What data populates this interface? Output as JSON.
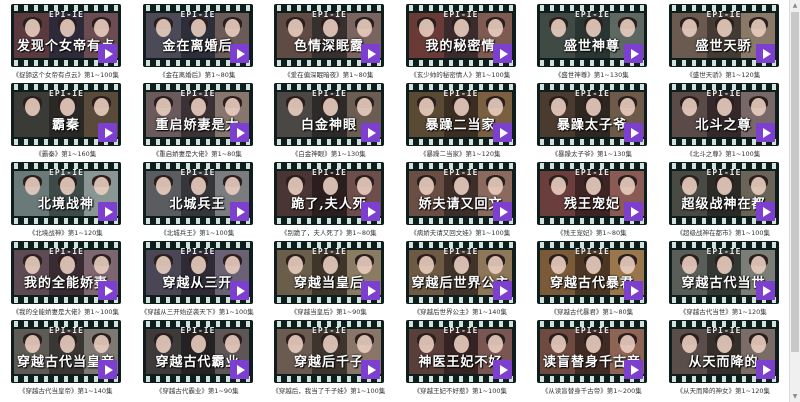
{
  "app": {
    "logo_text": "EPI-IE"
  },
  "videos": [
    {
      "caption": "发现个女帝有点",
      "label": "《捉舔这个女帝有点云》第1~100集",
      "c1": "#5b3a3f",
      "c2": "#2e2a3a",
      "c3": "#6b4c52"
    },
    {
      "caption": "金在离婚后",
      "label": "《金在离婚后》第1~80集",
      "c1": "#4b4a56",
      "c2": "#2c2f3a",
      "c3": "#6a5a58"
    },
    {
      "caption": "色情深眠露",
      "label": "《爱在偏深眠暗夜》第1~80集",
      "c1": "#5f4a44",
      "c2": "#37302f",
      "c3": "#7a6460"
    },
    {
      "caption": "我的秘密情",
      "label": "《玄少帅的秘密情人》第1~100集",
      "c1": "#6a3b36",
      "c2": "#3b2b2d",
      "c3": "#7e5a50"
    },
    {
      "caption": "盛世神尊",
      "label": "《盛世神尊》第1~130集",
      "c1": "#3f4a45",
      "c2": "#2a3532",
      "c3": "#5d6863"
    },
    {
      "caption": "盛世天骄",
      "label": "《盛世天骄》第1~120集",
      "c1": "#6a5a50",
      "c2": "#433a34",
      "c3": "#8a7868"
    },
    {
      "caption": "霸秦",
      "label": "《霸秦》第1~160集",
      "c1": "#3a3a36",
      "c2": "#2a2824",
      "c3": "#5a4a3a"
    },
    {
      "caption": "重启娇妻是太",
      "label": "《重启娇妻是大佬》第1~80集",
      "c1": "#6a5a5c",
      "c2": "#3a3234",
      "c3": "#86766e"
    },
    {
      "caption": "白金神眼",
      "label": "《白金神眼》第1~130集",
      "c1": "#4a4744",
      "c2": "#2c2b2a",
      "c3": "#6b5d52"
    },
    {
      "caption": "暴躁二当家",
      "label": "《暴躁二当家》第1~120集",
      "c1": "#5a4a34",
      "c2": "#3a2e22",
      "c3": "#7a6040"
    },
    {
      "caption": "暴躁太子爷",
      "label": "《暴躁太子爷》第1~130集",
      "c1": "#4a3a30",
      "c2": "#2e2620",
      "c3": "#6e5a48"
    },
    {
      "caption": "北斗之尊",
      "label": "《北斗之尊》第1~100集",
      "c1": "#5a4a48",
      "c2": "#33292a",
      "c3": "#786868"
    },
    {
      "caption": "北境战神",
      "label": "《北境战神》第1~120集",
      "c1": "#6a7a78",
      "c2": "#3c4a48",
      "c3": "#8a9694"
    },
    {
      "caption": "北城兵王",
      "label": "《北城兵王》第1~100集",
      "c1": "#5a5c60",
      "c2": "#34363a",
      "c3": "#7a7c80"
    },
    {
      "caption": "跪了,夫人死",
      "label": "《别跪了，夫人死了》第1~80集",
      "c1": "#4a3434",
      "c2": "#2a1e1e",
      "c3": "#6e4e4a"
    },
    {
      "caption": "娇夫请又回文",
      "label": "《病娇夫请又回文娃》第1~100集",
      "c1": "#6a4e44",
      "c2": "#3e2e2a",
      "c3": "#8a6a5e"
    },
    {
      "caption": "残王宠妃",
      "label": "《残王宠妃》第1~80集",
      "c1": "#6a3e3c",
      "c2": "#3e2424",
      "c3": "#8a5a54"
    },
    {
      "caption": "超级战神在都",
      "label": "《超级战神在都市》第1~100集",
      "c1": "#4a4a44",
      "c2": "#2a2a26",
      "c3": "#6a6458"
    },
    {
      "caption": "我的全能娇妻",
      "label": "《我的全能娇妻是大佬》第1~100集",
      "c1": "#5e4a52",
      "c2": "#382c32",
      "c3": "#7e6670"
    },
    {
      "caption": "穿越从三开",
      "label": "《穿越从三开始逆袭天下》第1~100集",
      "c1": "#4a4656",
      "c2": "#2e2a36",
      "c3": "#6a6274"
    },
    {
      "caption": "穿越当皇后",
      "label": "《穿越当皇后》第1~90集",
      "c1": "#6a5e4a",
      "c2": "#3e362a",
      "c3": "#8a7c62"
    },
    {
      "caption": "穿越后世界公主",
      "label": "《穿越后世界公主》第1~140集",
      "c1": "#6e5a44",
      "c2": "#40342a",
      "c3": "#8e7658"
    },
    {
      "caption": "穿越古代暴君",
      "label": "《穿越古代暴君》第1~80集",
      "c1": "#7a5a38",
      "c2": "#4a3622",
      "c3": "#9a764c"
    },
    {
      "caption": "穿越古代当世",
      "label": "《穿越古代当世》第1~120集",
      "c1": "#5a5e58",
      "c2": "#343834",
      "c3": "#7a7e76"
    },
    {
      "caption": "穿越古代当皇帝",
      "label": "《穿越古代当皇帝》第1~140集",
      "c1": "#5e5a56",
      "c2": "#3a3634",
      "c3": "#7e7872"
    },
    {
      "caption": "穿越古代霸业",
      "label": "《穿越古代霸业》第1~90集",
      "c1": "#3e3a3a",
      "c2": "#242222",
      "c3": "#5e5656"
    },
    {
      "caption": "穿越后千子",
      "label": "《穿越后，我当了千子娃》第1~100集",
      "c1": "#6a5a50",
      "c2": "#3e342e",
      "c3": "#8a7668"
    },
    {
      "caption": "神医王妃不好",
      "label": "《穿越王妃不好惹》第1~100集",
      "c1": "#5a3e3a",
      "c2": "#362424",
      "c3": "#7a5652"
    },
    {
      "caption": "读盲替身千古帝",
      "label": "《从读盲替身千古帝》第1~200集",
      "c1": "#6e4a40",
      "c2": "#402a24",
      "c3": "#8e6454"
    },
    {
      "caption": "从天而降的",
      "label": "《从天而降的神女》第1~120集",
      "c1": "#5a4e4a",
      "c2": "#36302c",
      "c3": "#7a6c66"
    }
  ]
}
